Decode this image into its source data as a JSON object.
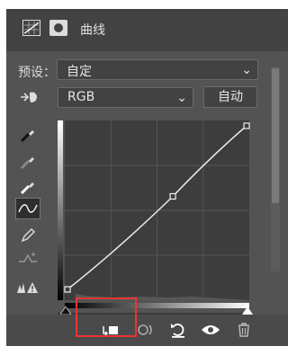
{
  "header": {
    "title": "曲线",
    "icons": [
      "curves-adjustment-icon",
      "layer-mask-icon"
    ]
  },
  "preset": {
    "label": "预设：",
    "value": "自定",
    "chevron": "⌄"
  },
  "channel": {
    "value": "RGB",
    "chevron": "⌄",
    "auto_label": "自动",
    "icon": "hand-target-icon"
  },
  "tools": [
    "black-point-eyedropper-icon",
    "gray-point-eyedropper-icon",
    "white-point-eyedropper-icon",
    "curve-point-tool-icon",
    "pencil-draw-icon",
    "smooth-curve-icon",
    "clipping-warning-icon"
  ],
  "curve": {
    "points": [
      [
        0,
        0
      ],
      [
        150,
        145
      ],
      [
        255,
        255
      ]
    ],
    "grid_divisions": 4
  },
  "footer": {
    "icons": [
      "clip-to-layer-icon",
      "view-previous-state-icon",
      "reset-icon",
      "visibility-eye-icon",
      "trash-icon"
    ]
  },
  "colors": {
    "panel": "#535353",
    "header": "#424242",
    "highlight": "#ee3333"
  }
}
